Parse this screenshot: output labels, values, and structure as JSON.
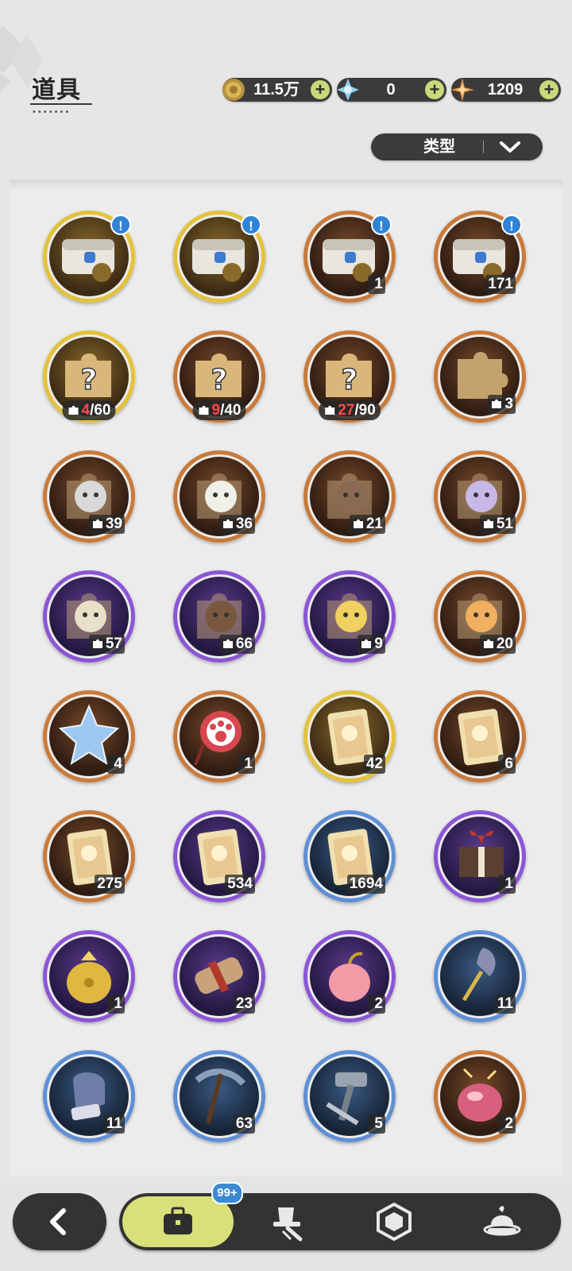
{
  "header": {
    "title": "道具",
    "title_dots": "•••••••"
  },
  "currencies": [
    {
      "icon": "gold-coin-icon",
      "value": "11.5万"
    },
    {
      "icon": "crystal-icon",
      "value": "0"
    },
    {
      "icon": "star-gem-icon",
      "value": "1209"
    }
  ],
  "filter": {
    "label": "类型"
  },
  "items": [
    {
      "name": "treasure-chest-gold-1",
      "icon": "treasure-chest-icon",
      "rarity": "gold",
      "alert": true
    },
    {
      "name": "treasure-chest-gold-2",
      "icon": "treasure-chest-icon",
      "rarity": "gold",
      "alert": true
    },
    {
      "name": "treasure-chest-orange-1",
      "icon": "treasure-chest-icon",
      "rarity": "orange",
      "alert": true,
      "count": "1"
    },
    {
      "name": "treasure-chest-orange-2",
      "icon": "treasure-chest-icon",
      "rarity": "orange",
      "alert": true,
      "count": "171"
    },
    {
      "name": "mystery-fragment-gold",
      "icon": "mystery-puzzle-icon",
      "rarity": "gold",
      "frag_cur": "4",
      "frag_total": "/60"
    },
    {
      "name": "mystery-fragment-orange-1",
      "icon": "mystery-puzzle-icon",
      "rarity": "orange",
      "frag_cur": "9",
      "frag_total": "/40"
    },
    {
      "name": "mystery-fragment-orange-2",
      "icon": "mystery-puzzle-icon",
      "rarity": "orange",
      "frag_cur": "27",
      "frag_total": "/90"
    },
    {
      "name": "puzzle-bear-fragment",
      "icon": "puzzle-piece-icon",
      "rarity": "orange",
      "piece": "3"
    },
    {
      "name": "knight-pet-fragment",
      "icon": "knight-pet-icon",
      "rarity": "orange",
      "piece": "39"
    },
    {
      "name": "white-pet-fragment",
      "icon": "white-pet-icon",
      "rarity": "orange",
      "piece": "36"
    },
    {
      "name": "brown-pet-fragment",
      "icon": "brown-pet-icon",
      "rarity": "orange",
      "piece": "21"
    },
    {
      "name": "purple-pet-fragment",
      "icon": "purple-pet-icon",
      "rarity": "orange",
      "piece": "51"
    },
    {
      "name": "frog-pet-fragment",
      "icon": "frog-pet-icon",
      "rarity": "purple",
      "piece": "57"
    },
    {
      "name": "bear-pet-fragment",
      "icon": "bear-pet-icon",
      "rarity": "purple",
      "piece": "66"
    },
    {
      "name": "chick-pet-fragment",
      "icon": "chick-pet-icon",
      "rarity": "purple",
      "piece": "9"
    },
    {
      "name": "tiger-pet-fragment",
      "icon": "tiger-pet-icon",
      "rarity": "orange",
      "piece": "20"
    },
    {
      "name": "ice-star-crystal",
      "icon": "ice-crystal-icon",
      "rarity": "orange",
      "count": "4"
    },
    {
      "name": "paw-medallion",
      "icon": "paw-medallion-icon",
      "rarity": "orange",
      "count": "1"
    },
    {
      "name": "gold-card",
      "icon": "character-card-icon",
      "rarity": "gold",
      "count": "42"
    },
    {
      "name": "rainbow-card",
      "icon": "character-card-icon",
      "rarity": "orange",
      "count": "6"
    },
    {
      "name": "orange-card",
      "icon": "character-card-icon",
      "rarity": "orange",
      "count": "275"
    },
    {
      "name": "purple-card",
      "icon": "character-card-icon",
      "rarity": "purple",
      "count": "534"
    },
    {
      "name": "blue-card",
      "icon": "character-card-icon",
      "rarity": "blue",
      "count": "1694"
    },
    {
      "name": "gift-box",
      "icon": "gift-box-icon",
      "rarity": "purple",
      "count": "1"
    },
    {
      "name": "golden-bag",
      "icon": "golden-bag-icon",
      "rarity": "purple",
      "count": "1"
    },
    {
      "name": "scroll",
      "icon": "scroll-icon",
      "rarity": "purple",
      "count": "23"
    },
    {
      "name": "pink-apple",
      "icon": "apple-icon",
      "rarity": "purple",
      "count": "2"
    },
    {
      "name": "shovel",
      "icon": "shovel-icon",
      "rarity": "blue",
      "count": "11"
    },
    {
      "name": "glove",
      "icon": "glove-icon",
      "rarity": "blue",
      "count": "11"
    },
    {
      "name": "pickaxe",
      "icon": "pickaxe-icon",
      "rarity": "blue",
      "count": "63"
    },
    {
      "name": "hammer",
      "icon": "hammer-icon",
      "rarity": "blue",
      "count": "5"
    },
    {
      "name": "ruby-fruit",
      "icon": "ruby-fruit-icon",
      "rarity": "orange",
      "count": "2"
    }
  ],
  "nav": {
    "back_icon": "back-arrow-icon",
    "tabs": [
      {
        "icon": "bag-icon",
        "active": true,
        "badge": "99+"
      },
      {
        "icon": "hat-sword-icon"
      },
      {
        "icon": "hexagon-gem-icon"
      },
      {
        "icon": "dessert-icon"
      }
    ]
  },
  "colors": {
    "gold": "#e3c23c",
    "orange": "#c97a3a",
    "purple": "#8b55d6",
    "blue": "#5e8fd6",
    "accent": "#d9e07a",
    "dark": "#333333",
    "badge": "#3a8ad6"
  }
}
